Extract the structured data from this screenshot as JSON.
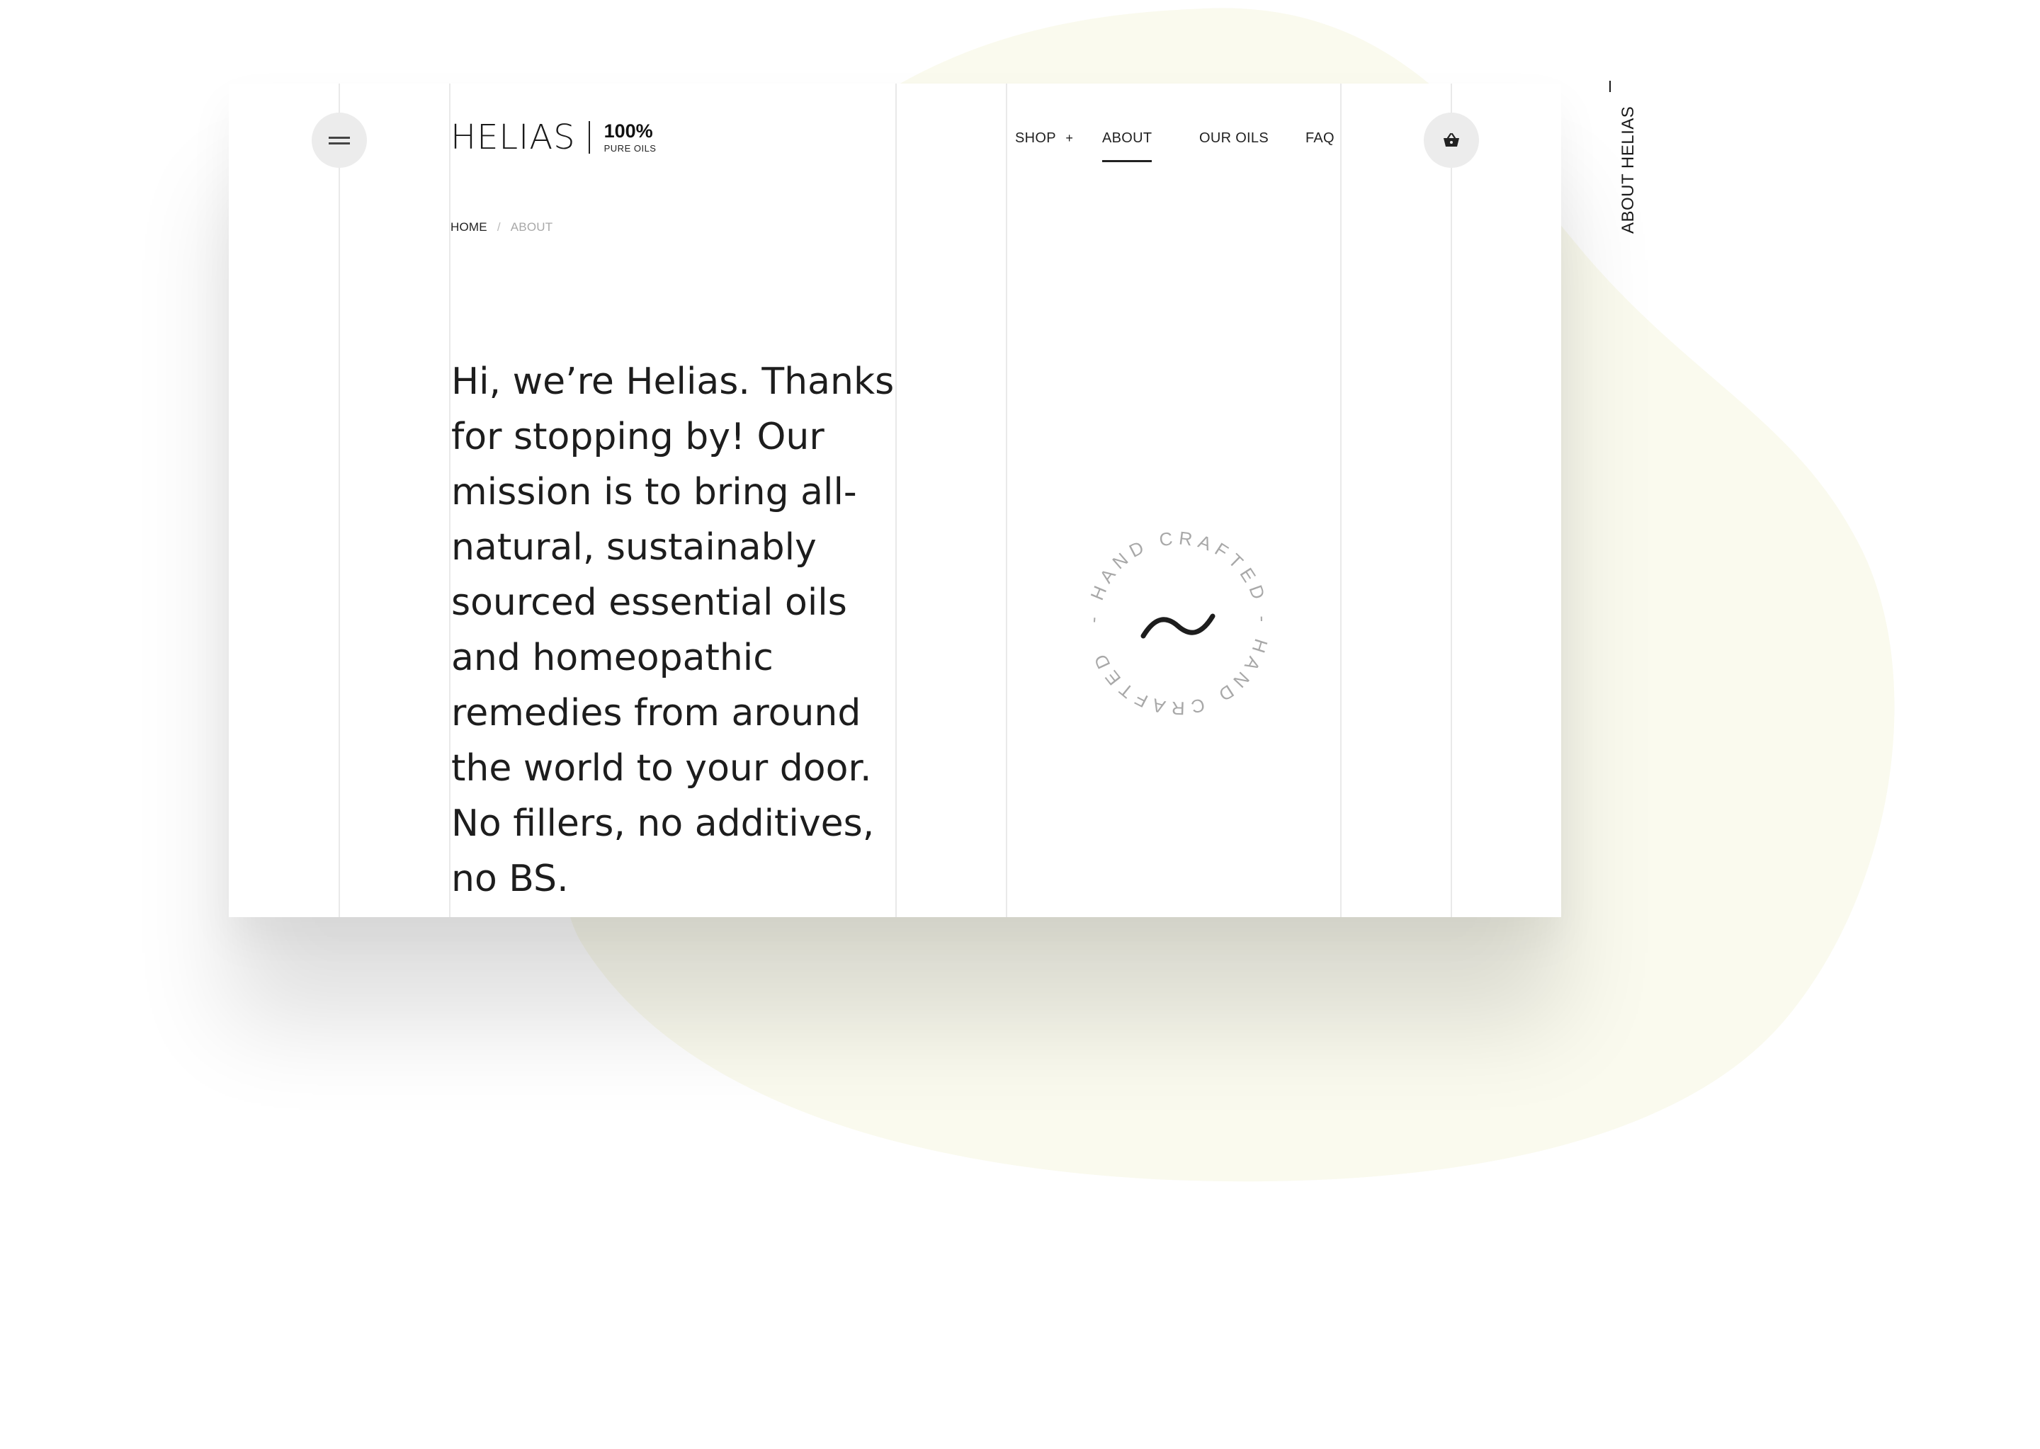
{
  "brand": {
    "name": "HELIAS",
    "badge_main": "100%",
    "badge_sub": "PURE OILS"
  },
  "nav": {
    "items": [
      {
        "label": "SHOP",
        "suffix": "+"
      },
      {
        "label": "ABOUT",
        "active": true
      },
      {
        "label": "OUR OILS"
      },
      {
        "label": "FAQ"
      }
    ]
  },
  "icons": {
    "menu": "hamburger-icon",
    "cart": "basket-icon",
    "badge": "tilde-icon"
  },
  "breadcrumb": {
    "home": "HOME",
    "separator": "/",
    "current": "ABOUT"
  },
  "intro": {
    "text": "Hi, we’re Helias. Thanks for stopping by! Our mission is to bring all-natural, sustainably sourced essential oils and homeopathic remedies from around the world to your door. No fillers, no additives, no BS."
  },
  "stamp": {
    "text": "- HAND CRAFTED - HAND CRAFTED "
  },
  "side": {
    "label": "ABOUT HELIAS"
  },
  "colors": {
    "background": "#ffffff",
    "blob": "#fafaee",
    "text": "#1d1d1d",
    "grid_line": "#e9e9e9",
    "button_bg": "#ececec",
    "stamp_text": "#a8a8a8"
  }
}
